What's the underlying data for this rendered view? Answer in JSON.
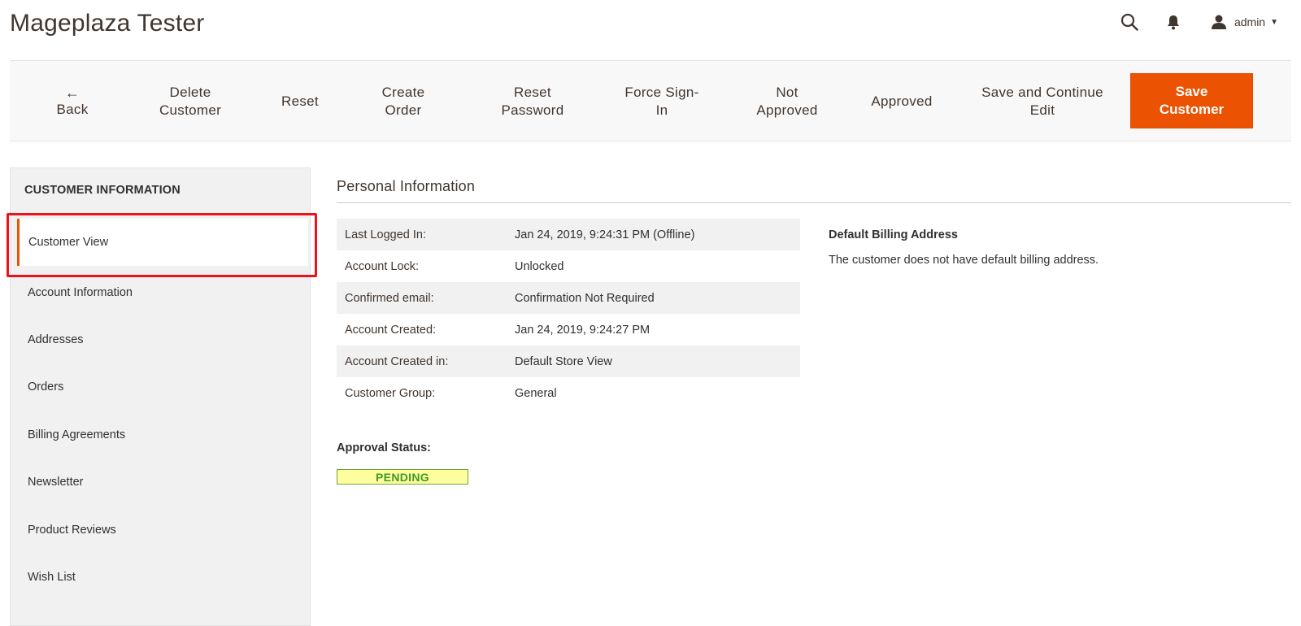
{
  "header": {
    "title": "Mageplaza Tester",
    "user": "admin",
    "icons": [
      "search-icon",
      "bell-icon",
      "user-icon",
      "caret-down-icon"
    ]
  },
  "toolbar": {
    "back": {
      "arrow": "←",
      "label": "Back"
    },
    "delete": {
      "line1": "Delete",
      "line2": "Customer"
    },
    "reset": "Reset",
    "create_order": {
      "line1": "Create",
      "line2": "Order"
    },
    "reset_password": {
      "line1": "Reset",
      "line2": "Password"
    },
    "force_sign_in": {
      "line1": "Force Sign-",
      "line2": "In"
    },
    "not_approved": {
      "line1": "Not",
      "line2": "Approved"
    },
    "approved": "Approved",
    "save_continue": {
      "line1": "Save and Continue",
      "line2": "Edit"
    },
    "save_customer": {
      "line1": "Save",
      "line2": "Customer"
    }
  },
  "sidebar": {
    "title": "CUSTOMER INFORMATION",
    "items": [
      {
        "label": "Customer View",
        "active": true
      },
      {
        "label": "Account Information",
        "active": false
      },
      {
        "label": "Addresses",
        "active": false
      },
      {
        "label": "Orders",
        "active": false
      },
      {
        "label": "Billing Agreements",
        "active": false
      },
      {
        "label": "Newsletter",
        "active": false
      },
      {
        "label": "Product Reviews",
        "active": false
      },
      {
        "label": "Wish List",
        "active": false
      }
    ]
  },
  "personal": {
    "title": "Personal Information",
    "rows": [
      {
        "label": "Last Logged In:",
        "value": "Jan 24, 2019, 9:24:31 PM (Offline)"
      },
      {
        "label": "Account Lock:",
        "value": "Unlocked"
      },
      {
        "label": "Confirmed email:",
        "value": "Confirmation Not Required"
      },
      {
        "label": "Account Created:",
        "value": "Jan 24, 2019, 9:24:27 PM"
      },
      {
        "label": "Account Created in:",
        "value": "Default Store View"
      },
      {
        "label": "Customer Group:",
        "value": "General"
      }
    ],
    "approval_label": "Approval Status:",
    "approval_value": "PENDING"
  },
  "billing": {
    "title": "Default Billing Address",
    "text": "The customer does not have default billing address."
  },
  "colors": {
    "accent": "#eb5202",
    "highlight": "#e8131b",
    "pending_bg": "#ffff9e",
    "pending_text": "#3d9a27"
  }
}
